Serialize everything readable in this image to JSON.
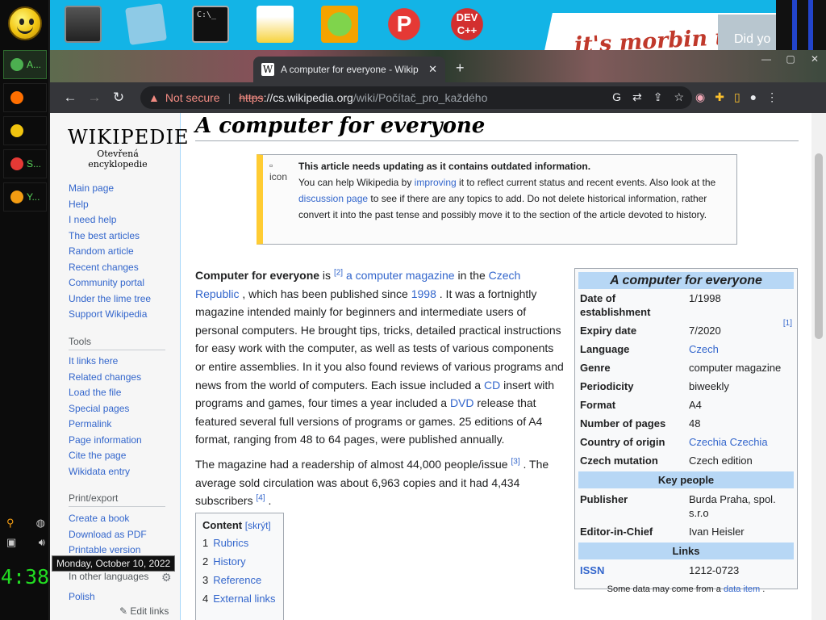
{
  "taskbar": {
    "buttons": [
      {
        "label": "A...",
        "icon": "chrome-icon",
        "color": "#4caf50",
        "active": true
      },
      {
        "label": "",
        "icon": "firefox-icon",
        "color": "#ff6f00"
      },
      {
        "label": "",
        "icon": "folder-icon",
        "color": "#f1c40f"
      },
      {
        "label": "S...",
        "icon": "s-app-icon",
        "color": "#e53935"
      },
      {
        "label": "Y...",
        "icon": "yahoo-smiley-icon",
        "color": "#f39c12"
      }
    ],
    "clock": "4:38",
    "tooltip": "Monday, October 10, 2022"
  },
  "desktop": {
    "icons": [
      "book-app-icon",
      "sticky-notes-icon",
      "command-prompt-icon",
      "cheese-app-icon",
      "angry-pig-icon",
      "p-app-icon",
      "dev-cpp-icon"
    ],
    "wallpaper_text": "it's morbin t",
    "overlay_text": "Did yo"
  },
  "browser": {
    "tab_title": "A computer for everyone - Wikip",
    "tab_close": "✕",
    "new_tab": "+",
    "not_secure": "Not secure",
    "url_scheme": "https",
    "url_host": "://cs.wikipedia.org",
    "url_path": "/wiki/Počítač_pro_každého"
  },
  "sidebar": {
    "logo_word": "WIKIPEDIE",
    "logo_sub": "Otevřená encyklopedie",
    "nav": [
      "Main page",
      "Help",
      "I need help",
      "The best articles",
      "Random article",
      "Recent changes",
      "Community portal",
      "Under the lime tree",
      "Support Wikipedia"
    ],
    "tools_heading": "Tools",
    "tools": [
      "It links here",
      "Related changes",
      "Load the file",
      "Special pages",
      "Permalink",
      "Page information",
      "Cite the page",
      "Wikidata entry"
    ],
    "print_heading": "Print/export",
    "print": [
      "Create a book",
      "Download as PDF",
      "Printable version"
    ],
    "langs_heading": "In other languages",
    "polish": "Polish",
    "edit_links": "✎ Edit links"
  },
  "article": {
    "title": "A computer for everyone",
    "ambox": {
      "icon_alt": "icon",
      "heading": "This article needs updating as it contains outdated information.",
      "t1": "You can help Wikipedia by ",
      "link1": "improving",
      "t2": " it to reflect current status and recent events. Also look at the ",
      "link2": "discussion page",
      "t3": " to see if there are any topics to add. Do not delete historical information, rather convert it into the past tense and possibly move it to the section of the article devoted to history."
    },
    "p1": {
      "bold": "Computer for everyone",
      "a": " is ",
      "ref1": "[2]",
      "link1": "a computer magazine",
      "b": " in the ",
      "link2": "Czech Republic",
      "c": " , which has been published since ",
      "link3": "1998",
      "d": " . It was a fortnightly magazine intended mainly for beginners and intermediate users of personal computers. He brought tips, tricks, detailed practical instructions for easy work with the computer, as well as tests of various components or entire assemblies. In it you also found reviews of various programs and news from the world of computers. Each issue included a ",
      "link4": "CD",
      "e": " insert with programs and games, four times a year included a ",
      "link5": "DVD",
      "f": " release that featured several full versions of programs or games. 25 editions of A4 format, ranging from 48 to 64 pages, were published annually."
    },
    "p2": {
      "a": "The magazine had a readership of almost 44,000 people/issue ",
      "ref3": "[3]",
      "b": " . The average sold circulation was about 6,963 copies and it had 4,434 subscribers ",
      "ref4": "[4]",
      "c": " ."
    },
    "toc": {
      "title": "Content",
      "hide": "[skrýt]",
      "items": [
        {
          "n": "1",
          "label": "Rubrics"
        },
        {
          "n": "2",
          "label": "History"
        },
        {
          "n": "3",
          "label": "Reference"
        },
        {
          "n": "4",
          "label": "External links"
        }
      ]
    }
  },
  "infobox": {
    "title": "A computer for everyone",
    "rows": [
      {
        "k": "Date of establishment",
        "v": "1/1998"
      },
      {
        "k": "Expiry date",
        "v": "7/2020",
        "ref": "[1]"
      },
      {
        "k": "Language",
        "v": "Czech",
        "link": true
      },
      {
        "k": "Genre",
        "v": "computer magazine"
      },
      {
        "k": "Periodicity",
        "v": "biweekly"
      },
      {
        "k": "Format",
        "v": "A4"
      },
      {
        "k": "Number of pages",
        "v": "48"
      },
      {
        "k": "Country of origin",
        "v": "Czechia Czechia",
        "link": true
      },
      {
        "k": "Czech mutation",
        "v": "Czech edition"
      }
    ],
    "key_people_heading": "Key people",
    "people": [
      {
        "k": "Publisher",
        "v": "Burda Praha, spol. s.r.o"
      },
      {
        "k": "Editor-in-Chief",
        "v": "Ivan Heisler"
      }
    ],
    "links_heading": "Links",
    "issn_label": "ISSN",
    "issn": "1212-0723",
    "footer_a": "Some data may come from a ",
    "footer_link": "data item",
    "footer_b": " ."
  }
}
